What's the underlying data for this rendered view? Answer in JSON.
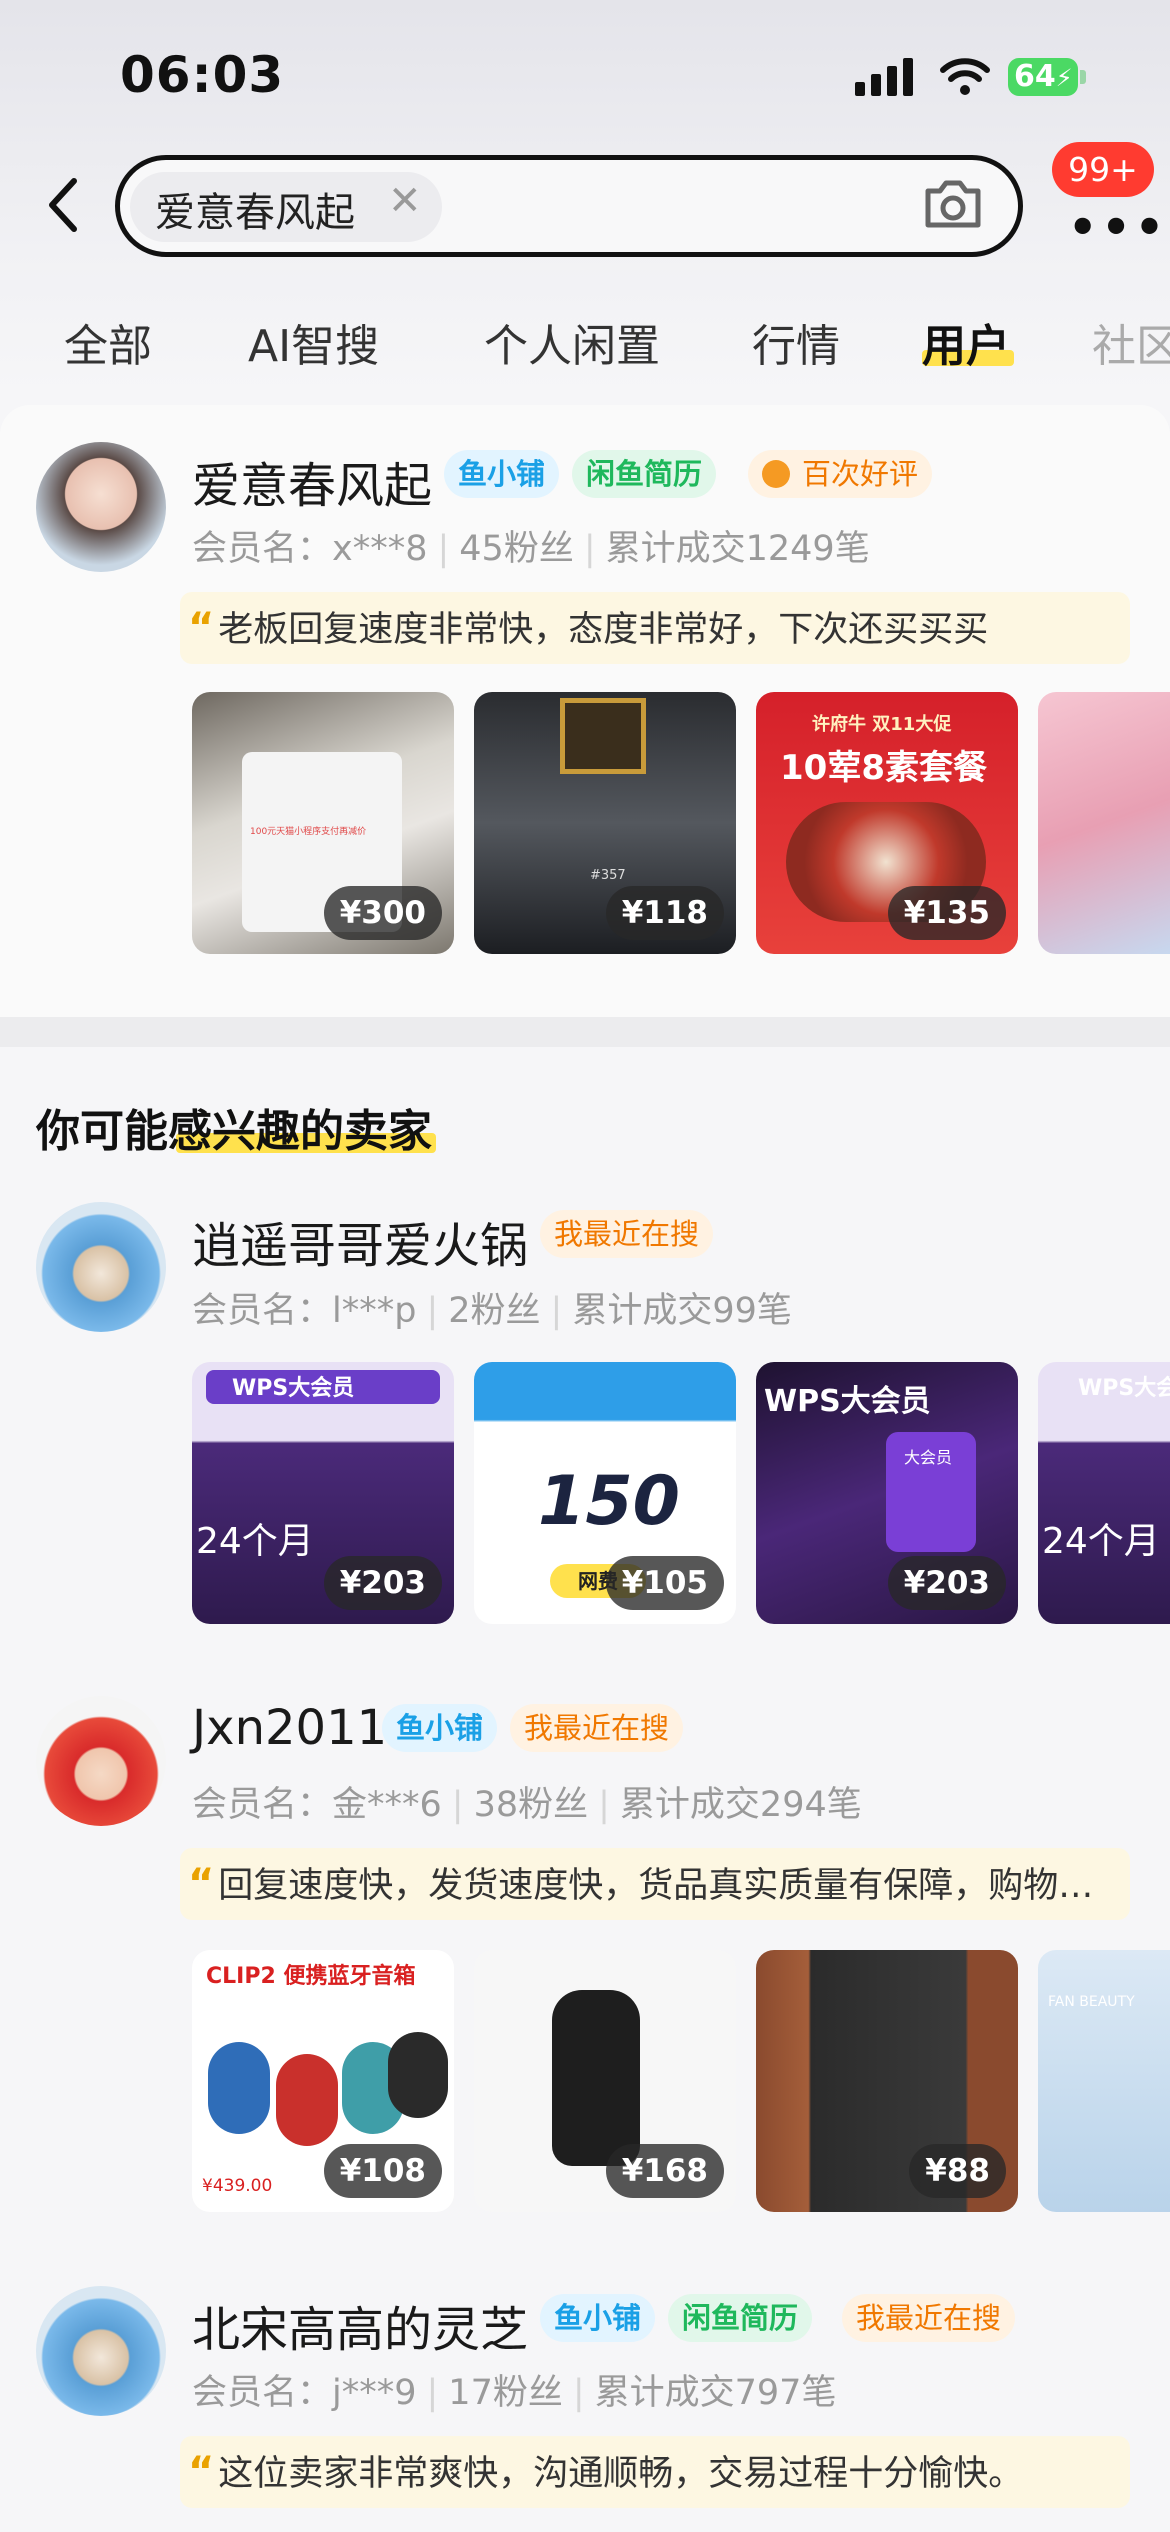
{
  "status_bar": {
    "time": "06:03",
    "battery": "64"
  },
  "search": {
    "query": "爱意春风起"
  },
  "header": {
    "badge": "99+"
  },
  "tabs": [
    "全部",
    "AI智搜",
    "个人闲置",
    "行情",
    "用户",
    "社区"
  ],
  "active_tab": "用户",
  "top_user": {
    "name": "爱意春风起",
    "tags": [
      "鱼小铺",
      "闲鱼简历",
      "百次好评"
    ],
    "member": "会员名：x***8",
    "fans": "45粉丝",
    "deals": "累计成交1249笔",
    "review": "老板回复速度非常快，态度非常好，下次还买买买",
    "items": [
      {
        "price": "¥300",
        "caption": "100元天猫小程序支付再减价"
      },
      {
        "price": "¥118",
        "caption": "#357"
      },
      {
        "price": "¥135",
        "caption": "10荤8素套餐",
        "brand": "许府牛 双11大促"
      },
      {
        "price": ""
      }
    ]
  },
  "section_title": "你可能感兴趣的卖家",
  "sellers": [
    {
      "name": "逍遥哥哥爱火锅",
      "tags": [
        "我最近在搜"
      ],
      "member": "会员名：l***p",
      "fans": "2粉丝",
      "deals": "累计成交99笔",
      "review": "",
      "items": [
        {
          "price": "¥203",
          "caption": "WPS大会员",
          "sub": "24个月"
        },
        {
          "price": "¥105",
          "caption": "150",
          "sub": "网费"
        },
        {
          "price": "¥203",
          "caption": "WPS大会员",
          "sub": "大会员"
        },
        {
          "price": "",
          "caption": "WPS大会员",
          "sub": "24个月"
        }
      ]
    },
    {
      "name": "Jxn2011",
      "tags": [
        "鱼小铺",
        "我最近在搜"
      ],
      "member": "会员名：金***6",
      "fans": "38粉丝",
      "deals": "累计成交294笔",
      "review": "回复速度快，发货速度快，货品真实质量有保障，购物…",
      "items": [
        {
          "price": "¥108",
          "caption": "CLIP2 便携蓝牙音箱",
          "sub": "¥439.00"
        },
        {
          "price": "¥168",
          "caption": ""
        },
        {
          "price": "¥88",
          "caption": ""
        },
        {
          "price": "",
          "caption": "FAN BEAUTY"
        }
      ]
    },
    {
      "name": "北宋高高的灵芝",
      "tags": [
        "鱼小铺",
        "闲鱼简历",
        "我最近在搜"
      ],
      "member": "会员名：j***9",
      "fans": "17粉丝",
      "deals": "累计成交797笔",
      "review": "这位卖家非常爽快，沟通顺畅，交易过程十分愉快。"
    }
  ],
  "colors": {
    "accent_yellow": "#ffe14d",
    "badge_red": "#ff3b30",
    "tag_blue": "#1aa0e6",
    "tag_green": "#1fb85c",
    "tag_orange": "#f07800"
  }
}
